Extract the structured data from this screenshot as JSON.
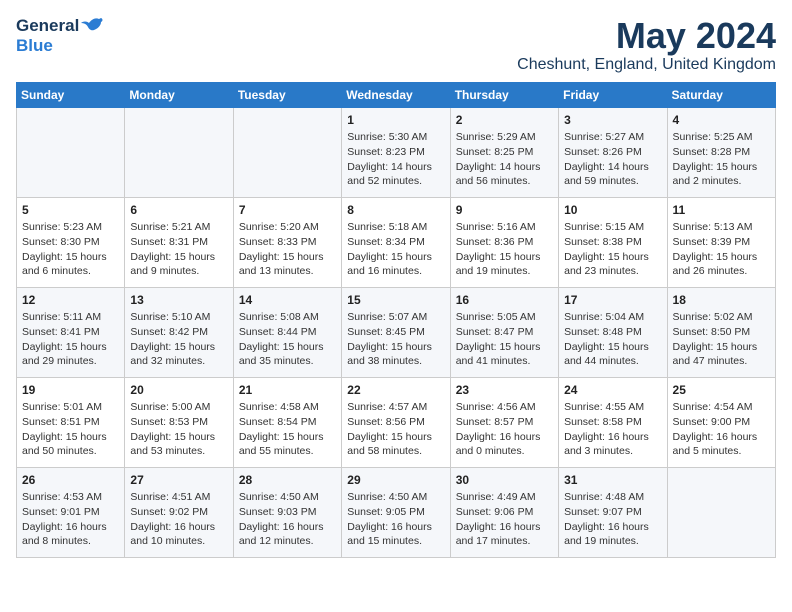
{
  "header": {
    "logo_general": "General",
    "logo_blue": "Blue",
    "month": "May 2024",
    "location": "Cheshunt, England, United Kingdom"
  },
  "weekdays": [
    "Sunday",
    "Monday",
    "Tuesday",
    "Wednesday",
    "Thursday",
    "Friday",
    "Saturday"
  ],
  "weeks": [
    [
      {
        "day": "",
        "info": ""
      },
      {
        "day": "",
        "info": ""
      },
      {
        "day": "",
        "info": ""
      },
      {
        "day": "1",
        "info": "Sunrise: 5:30 AM\nSunset: 8:23 PM\nDaylight: 14 hours and 52 minutes."
      },
      {
        "day": "2",
        "info": "Sunrise: 5:29 AM\nSunset: 8:25 PM\nDaylight: 14 hours and 56 minutes."
      },
      {
        "day": "3",
        "info": "Sunrise: 5:27 AM\nSunset: 8:26 PM\nDaylight: 14 hours and 59 minutes."
      },
      {
        "day": "4",
        "info": "Sunrise: 5:25 AM\nSunset: 8:28 PM\nDaylight: 15 hours and 2 minutes."
      }
    ],
    [
      {
        "day": "5",
        "info": "Sunrise: 5:23 AM\nSunset: 8:30 PM\nDaylight: 15 hours and 6 minutes."
      },
      {
        "day": "6",
        "info": "Sunrise: 5:21 AM\nSunset: 8:31 PM\nDaylight: 15 hours and 9 minutes."
      },
      {
        "day": "7",
        "info": "Sunrise: 5:20 AM\nSunset: 8:33 PM\nDaylight: 15 hours and 13 minutes."
      },
      {
        "day": "8",
        "info": "Sunrise: 5:18 AM\nSunset: 8:34 PM\nDaylight: 15 hours and 16 minutes."
      },
      {
        "day": "9",
        "info": "Sunrise: 5:16 AM\nSunset: 8:36 PM\nDaylight: 15 hours and 19 minutes."
      },
      {
        "day": "10",
        "info": "Sunrise: 5:15 AM\nSunset: 8:38 PM\nDaylight: 15 hours and 23 minutes."
      },
      {
        "day": "11",
        "info": "Sunrise: 5:13 AM\nSunset: 8:39 PM\nDaylight: 15 hours and 26 minutes."
      }
    ],
    [
      {
        "day": "12",
        "info": "Sunrise: 5:11 AM\nSunset: 8:41 PM\nDaylight: 15 hours and 29 minutes."
      },
      {
        "day": "13",
        "info": "Sunrise: 5:10 AM\nSunset: 8:42 PM\nDaylight: 15 hours and 32 minutes."
      },
      {
        "day": "14",
        "info": "Sunrise: 5:08 AM\nSunset: 8:44 PM\nDaylight: 15 hours and 35 minutes."
      },
      {
        "day": "15",
        "info": "Sunrise: 5:07 AM\nSunset: 8:45 PM\nDaylight: 15 hours and 38 minutes."
      },
      {
        "day": "16",
        "info": "Sunrise: 5:05 AM\nSunset: 8:47 PM\nDaylight: 15 hours and 41 minutes."
      },
      {
        "day": "17",
        "info": "Sunrise: 5:04 AM\nSunset: 8:48 PM\nDaylight: 15 hours and 44 minutes."
      },
      {
        "day": "18",
        "info": "Sunrise: 5:02 AM\nSunset: 8:50 PM\nDaylight: 15 hours and 47 minutes."
      }
    ],
    [
      {
        "day": "19",
        "info": "Sunrise: 5:01 AM\nSunset: 8:51 PM\nDaylight: 15 hours and 50 minutes."
      },
      {
        "day": "20",
        "info": "Sunrise: 5:00 AM\nSunset: 8:53 PM\nDaylight: 15 hours and 53 minutes."
      },
      {
        "day": "21",
        "info": "Sunrise: 4:58 AM\nSunset: 8:54 PM\nDaylight: 15 hours and 55 minutes."
      },
      {
        "day": "22",
        "info": "Sunrise: 4:57 AM\nSunset: 8:56 PM\nDaylight: 15 hours and 58 minutes."
      },
      {
        "day": "23",
        "info": "Sunrise: 4:56 AM\nSunset: 8:57 PM\nDaylight: 16 hours and 0 minutes."
      },
      {
        "day": "24",
        "info": "Sunrise: 4:55 AM\nSunset: 8:58 PM\nDaylight: 16 hours and 3 minutes."
      },
      {
        "day": "25",
        "info": "Sunrise: 4:54 AM\nSunset: 9:00 PM\nDaylight: 16 hours and 5 minutes."
      }
    ],
    [
      {
        "day": "26",
        "info": "Sunrise: 4:53 AM\nSunset: 9:01 PM\nDaylight: 16 hours and 8 minutes."
      },
      {
        "day": "27",
        "info": "Sunrise: 4:51 AM\nSunset: 9:02 PM\nDaylight: 16 hours and 10 minutes."
      },
      {
        "day": "28",
        "info": "Sunrise: 4:50 AM\nSunset: 9:03 PM\nDaylight: 16 hours and 12 minutes."
      },
      {
        "day": "29",
        "info": "Sunrise: 4:50 AM\nSunset: 9:05 PM\nDaylight: 16 hours and 15 minutes."
      },
      {
        "day": "30",
        "info": "Sunrise: 4:49 AM\nSunset: 9:06 PM\nDaylight: 16 hours and 17 minutes."
      },
      {
        "day": "31",
        "info": "Sunrise: 4:48 AM\nSunset: 9:07 PM\nDaylight: 16 hours and 19 minutes."
      },
      {
        "day": "",
        "info": ""
      }
    ]
  ]
}
